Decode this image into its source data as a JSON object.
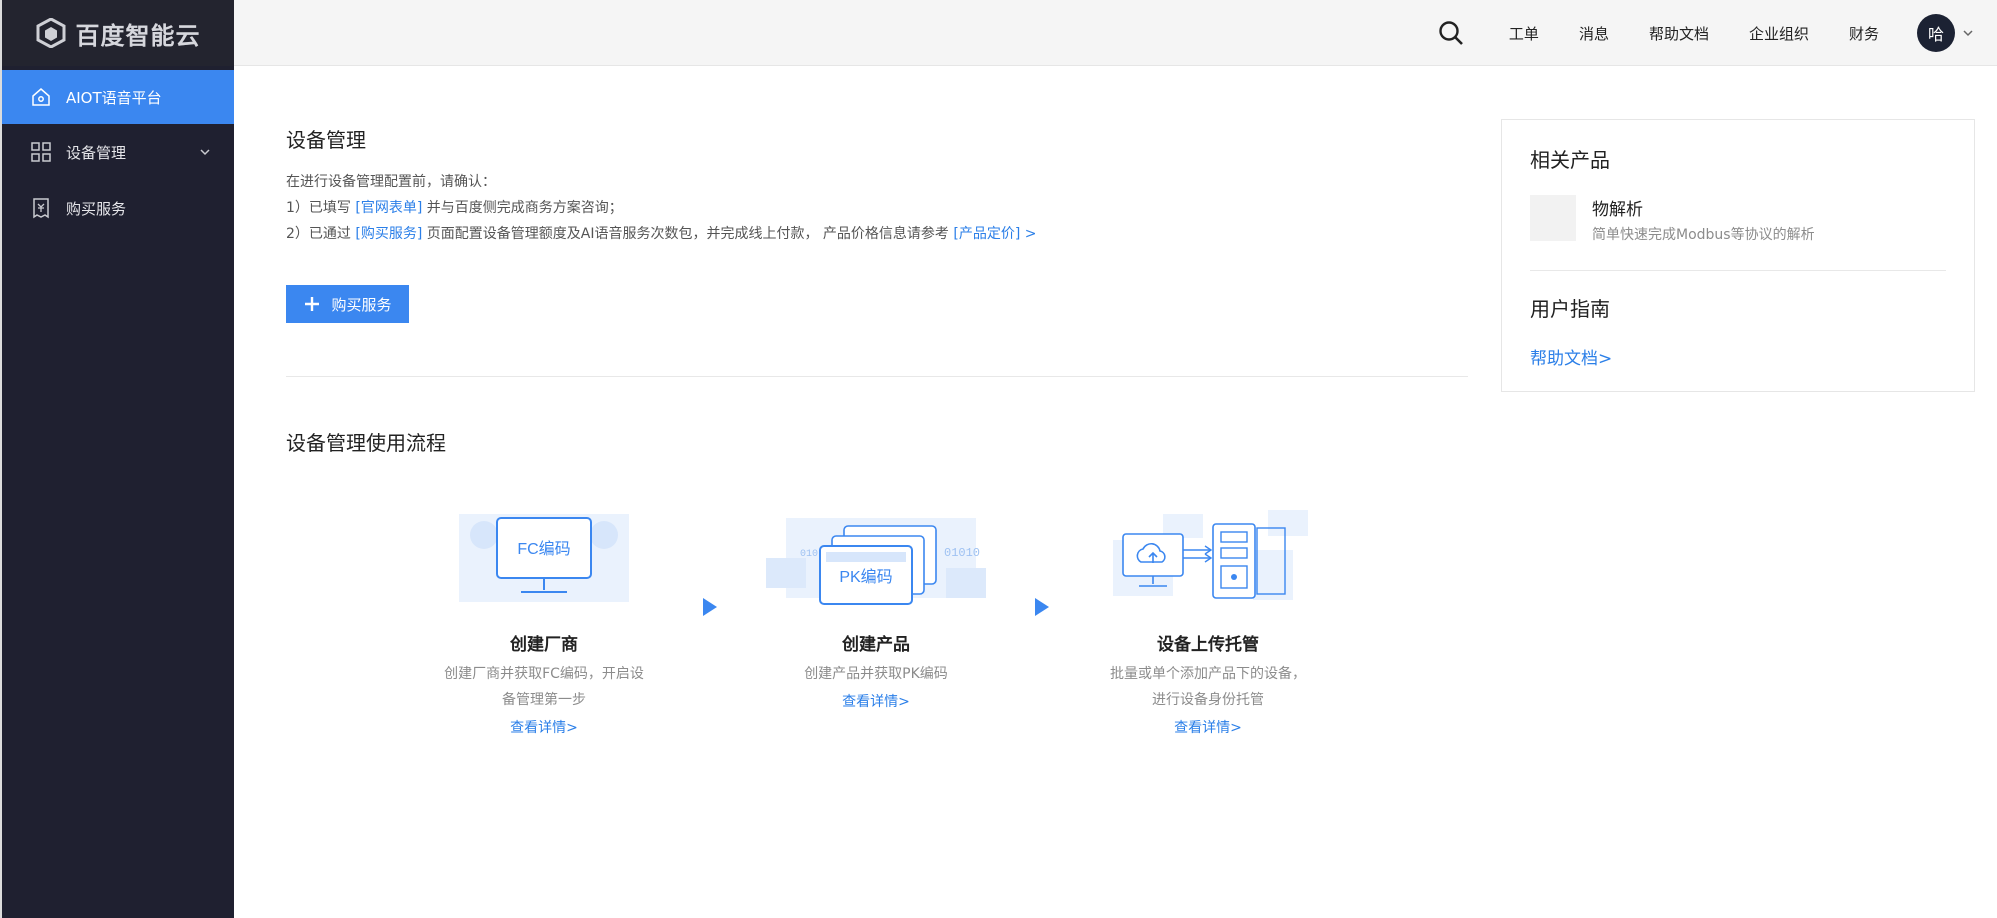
{
  "logo": {
    "text": "百度智能云"
  },
  "sidebar": {
    "items": [
      {
        "label": "AIOT语音平台",
        "icon": "home-icon",
        "active": true
      },
      {
        "label": "设备管理",
        "icon": "grid-icon",
        "expandable": true
      },
      {
        "label": "购买服务",
        "icon": "receipt-icon"
      }
    ]
  },
  "topbar": {
    "links": [
      "工单",
      "消息",
      "帮助文档",
      "企业组织",
      "财务"
    ],
    "avatar_text": "哈"
  },
  "main": {
    "title": "设备管理",
    "intro": "在进行设备管理配置前，请确认：",
    "line1": {
      "prefix": "1）已填写 ",
      "link": "[官网表单]",
      "suffix": " 并与百度侧完成商务方案咨询；"
    },
    "line2": {
      "prefix": "2）已通过 ",
      "link": "[购买服务]",
      "middle": " 页面配置设备管理额度及AI语音服务次数包，并完成线上付款， 产品价格信息请参考 ",
      "link2": "[产品定价] >"
    },
    "buy_button": "购买服务",
    "flow_title": "设备管理使用流程",
    "steps": [
      {
        "badge": "FC编码",
        "name": "创建厂商",
        "desc": "创建厂商并获取FC编码，开启设备管理第一步",
        "link": "查看详情>"
      },
      {
        "badge": "PK编码",
        "name": "创建产品",
        "desc": "创建产品并获取PK编码",
        "link": "查看详情>"
      },
      {
        "badge": "",
        "name": "设备上传托管",
        "desc": "批量或单个添加产品下的设备，进行设备身份托管",
        "link": "查看详情>"
      }
    ]
  },
  "panel": {
    "related_title": "相关产品",
    "product_name": "物解析",
    "product_desc": "简单快速完成Modbus等协议的解析",
    "guide_title": "用户指南",
    "guide_link": "帮助文档>"
  },
  "colors": {
    "accent": "#3b87f0",
    "sidebar_bg": "#1f2030",
    "link": "#2b7fe8"
  }
}
